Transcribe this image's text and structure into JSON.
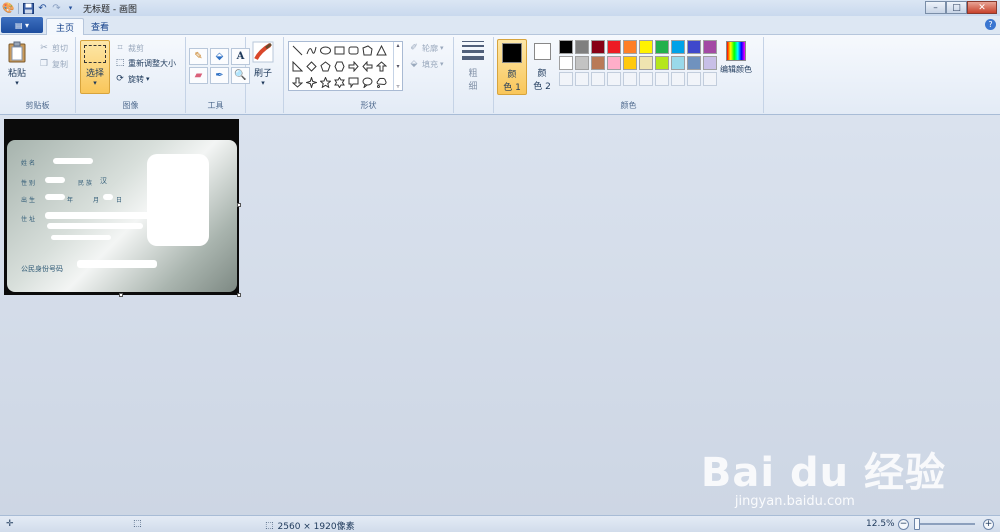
{
  "window": {
    "title": "无标题 - 画图"
  },
  "tabs": [
    {
      "label": "主页",
      "active": true
    },
    {
      "label": "查看",
      "active": false
    }
  ],
  "clipboard": {
    "paste": "粘贴",
    "cut": "剪切",
    "copy": "复制",
    "group": "剪贴板"
  },
  "image": {
    "select": "选择",
    "crop": "裁剪",
    "resize": "重新调整大小",
    "rotate": "旋转",
    "group": "图像"
  },
  "tools": {
    "group": "工具"
  },
  "brush": {
    "label": "刷子"
  },
  "shapes": {
    "outline": "轮廓",
    "fill": "填充",
    "group": "形状"
  },
  "size": {
    "line1": "粗",
    "line2": "细"
  },
  "colors": {
    "color1_line1": "颜",
    "color1_line2": "色 1",
    "color2_line1": "颜",
    "color2_line2": "色 2",
    "edit": "编辑颜色",
    "group": "颜色",
    "color1_value": "#000000",
    "color2_value": "#ffffff",
    "palette_row1": [
      "#000000",
      "#7f7f7f",
      "#880015",
      "#ed1c24",
      "#ff7f27",
      "#fff200",
      "#22b14c",
      "#00a2e8",
      "#3f48cc",
      "#a349a4"
    ],
    "palette_row2": [
      "#ffffff",
      "#c3c3c3",
      "#b97a57",
      "#ffaec9",
      "#ffc90e",
      "#efe4b0",
      "#b5e61d",
      "#99d9ea",
      "#7092be",
      "#c8bfe7"
    ]
  },
  "canvas_image": {
    "id_footer": "公民身份号码",
    "label_name": "姓名",
    "label_sex": "性别",
    "label_ethnicity": "民族",
    "label_ethnicity_value": "汉",
    "label_birth": "出生",
    "label_birth_mid": "年",
    "label_birth_month": "月",
    "label_birth_day": "日",
    "label_address": "住址"
  },
  "watermark": {
    "main": "Bai du 经验",
    "sub": "jingyan.baidu.com"
  },
  "status": {
    "dimensions": "2560 × 1920像素",
    "zoom": "12.5%"
  }
}
